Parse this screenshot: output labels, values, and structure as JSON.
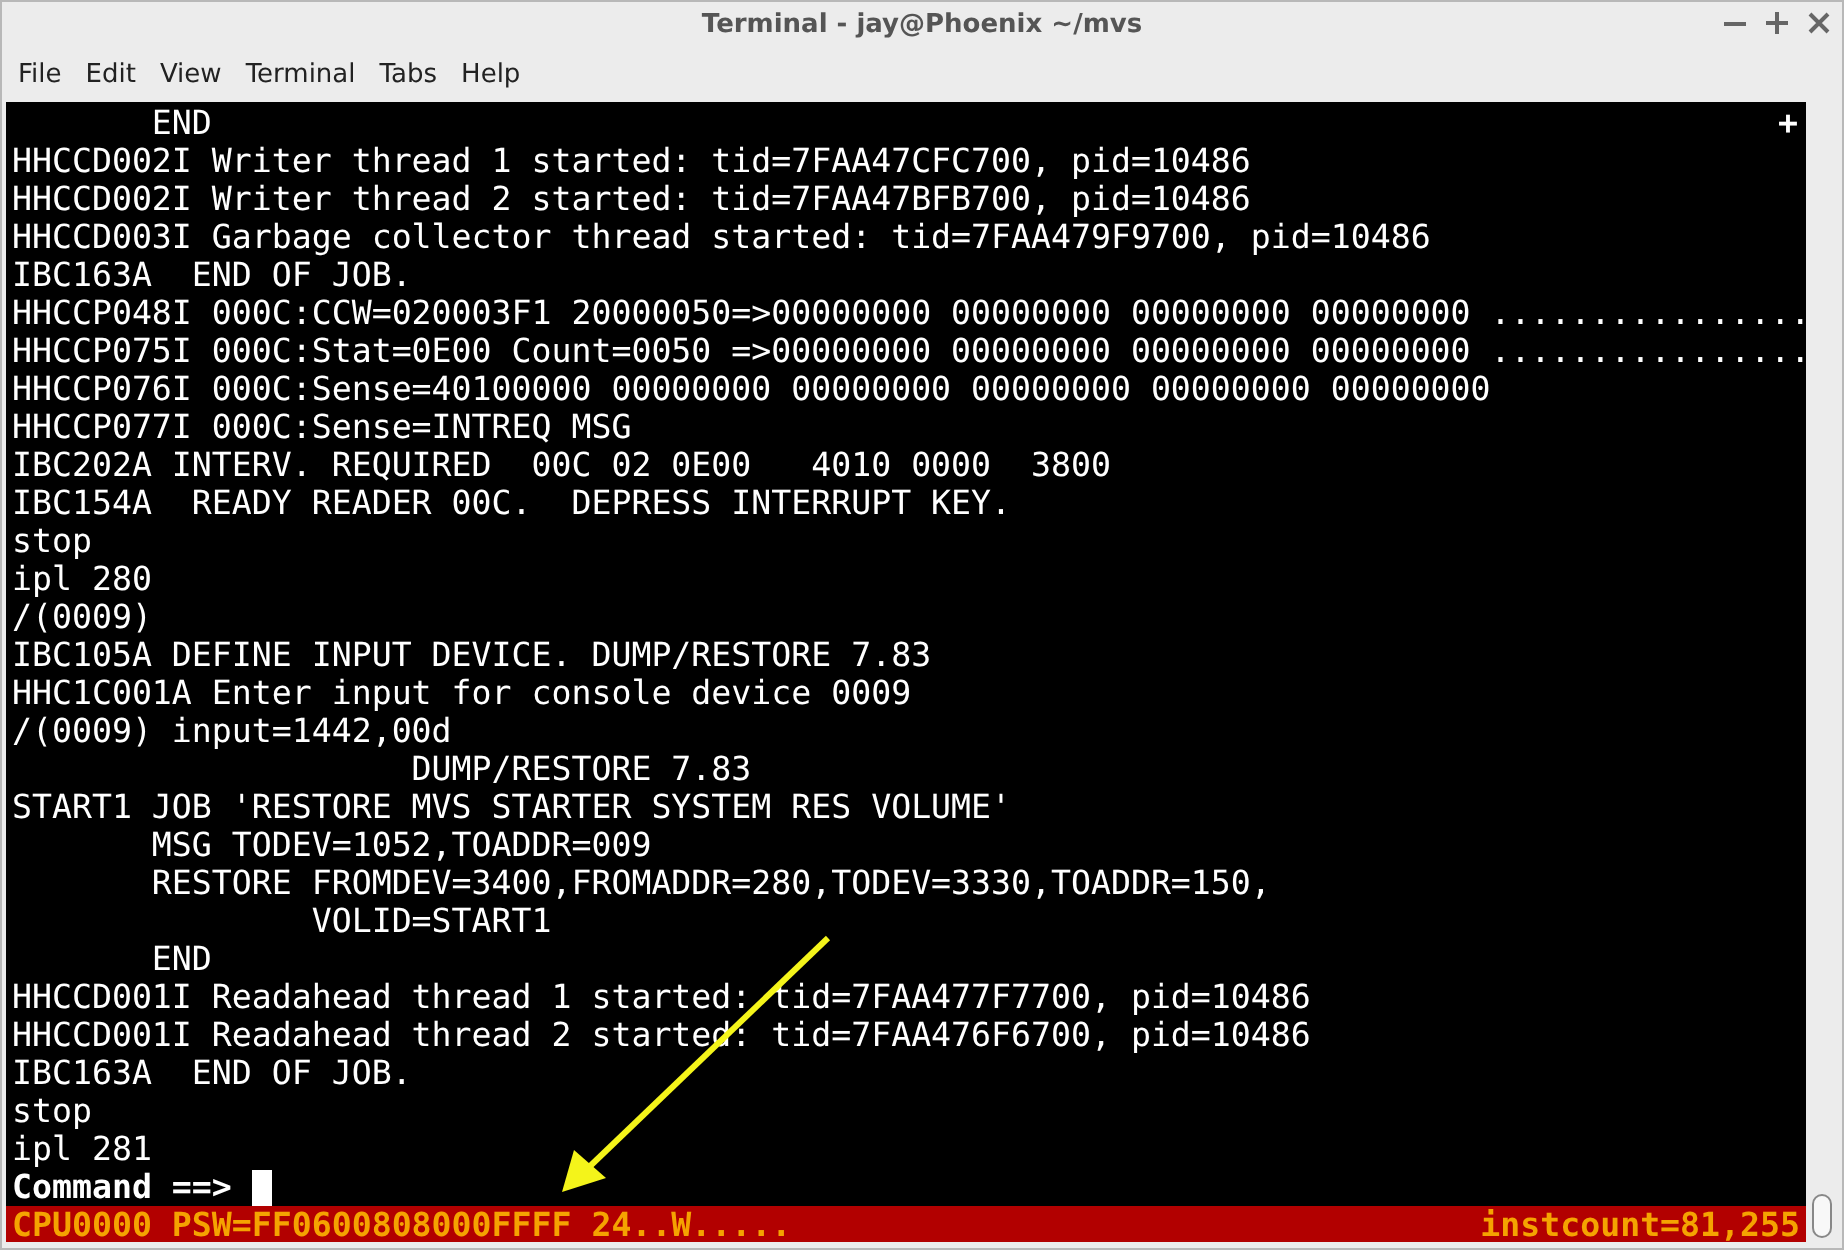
{
  "window": {
    "title": "Terminal - jay@Phoenix ~/mvs"
  },
  "menu": [
    "File",
    "Edit",
    "View",
    "Terminal",
    "Tabs",
    "Help"
  ],
  "terminal": {
    "corner_mark": "+",
    "lines": [
      {
        "text": "       END"
      },
      {
        "text": "HHCCD002I Writer thread 1 started: tid=7FAA47CFC700, pid=10486"
      },
      {
        "text": "HHCCD002I Writer thread 2 started: tid=7FAA47BFB700, pid=10486"
      },
      {
        "text": "HHCCD003I Garbage collector thread started: tid=7FAA479F9700, pid=10486"
      },
      {
        "text": "IBC163A  END OF JOB."
      },
      {
        "text": "HHCCP048I 000C:CCW=020003F1 20000050=>00000000 00000000 00000000 00000000 ................"
      },
      {
        "text": "HHCCP075I 000C:Stat=0E00 Count=0050 =>00000000 00000000 00000000 00000000 ................"
      },
      {
        "text": "HHCCP076I 000C:Sense=40100000 00000000 00000000 00000000 00000000 00000000"
      },
      {
        "text": "HHCCP077I 000C:Sense=INTREQ MSG"
      },
      {
        "text": "IBC202A INTERV. REQUIRED  00C 02 0E00   4010 0000  3800"
      },
      {
        "text": "IBC154A  READY READER 00C.  DEPRESS INTERRUPT KEY."
      },
      {
        "text": "stop"
      },
      {
        "text": "ipl 280"
      },
      {
        "text": "/(0009)"
      },
      {
        "text": "IBC105A DEFINE INPUT DEVICE. DUMP/RESTORE 7.83"
      },
      {
        "text": "HHC1C001A Enter input for console device 0009"
      },
      {
        "text": "/(0009) input=1442,00d"
      },
      {
        "text": "                    DUMP/RESTORE 7.83"
      },
      {
        "text": "START1 JOB 'RESTORE MVS STARTER SYSTEM RES VOLUME'"
      },
      {
        "text": "       MSG TODEV=1052,TOADDR=009"
      },
      {
        "text": "       RESTORE FROMDEV=3400,FROMADDR=280,TODEV=3330,TOADDR=150,"
      },
      {
        "text": "               VOLID=START1"
      },
      {
        "text": "       END"
      },
      {
        "text": "HHCCD001I Readahead thread 1 started: tid=7FAA477F7700, pid=10486"
      },
      {
        "text": "HHCCD001I Readahead thread 2 started: tid=7FAA476F6700, pid=10486"
      },
      {
        "text": "IBC163A  END OF JOB."
      },
      {
        "text": "stop"
      },
      {
        "text": "ipl 281"
      }
    ],
    "prompt": {
      "text": "Command ==>",
      "cursor": true
    }
  },
  "status_bar": {
    "left": "CPU0000 PSW=FF0600808000FFFF 24..W.....",
    "right": "instcount=81,255"
  }
}
